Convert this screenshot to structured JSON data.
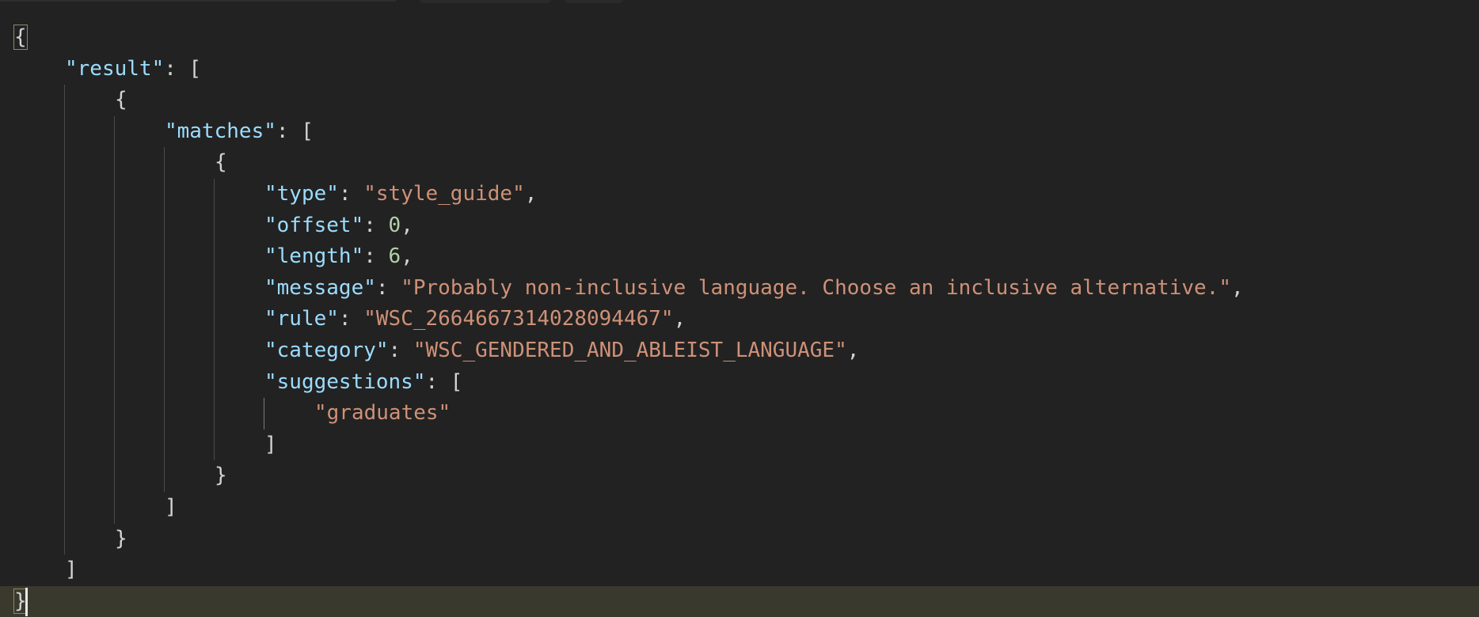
{
  "editor": {
    "lines": [
      {
        "tokens": [
          {
            "t": "{",
            "c": "pun"
          }
        ]
      },
      {
        "tokens": [
          {
            "t": "\"result\"",
            "c": "key"
          },
          {
            "t": ": [",
            "c": "pun"
          }
        ]
      },
      {
        "tokens": [
          {
            "t": "{",
            "c": "pun"
          }
        ]
      },
      {
        "tokens": [
          {
            "t": "\"matches\"",
            "c": "key"
          },
          {
            "t": ": [",
            "c": "pun"
          }
        ]
      },
      {
        "tokens": [
          {
            "t": "{",
            "c": "pun"
          }
        ]
      },
      {
        "tokens": [
          {
            "t": "\"type\"",
            "c": "key"
          },
          {
            "t": ": ",
            "c": "pun"
          },
          {
            "t": "\"style_guide\"",
            "c": "str"
          },
          {
            "t": ",",
            "c": "pun"
          }
        ]
      },
      {
        "tokens": [
          {
            "t": "\"offset\"",
            "c": "key"
          },
          {
            "t": ": ",
            "c": "pun"
          },
          {
            "t": "0",
            "c": "num"
          },
          {
            "t": ",",
            "c": "pun"
          }
        ]
      },
      {
        "tokens": [
          {
            "t": "\"length\"",
            "c": "key"
          },
          {
            "t": ": ",
            "c": "pun"
          },
          {
            "t": "6",
            "c": "num"
          },
          {
            "t": ",",
            "c": "pun"
          }
        ]
      },
      {
        "tokens": [
          {
            "t": "\"message\"",
            "c": "key"
          },
          {
            "t": ": ",
            "c": "pun"
          },
          {
            "t": "\"Probably non-inclusive language. Choose an inclusive alternative.\"",
            "c": "str"
          },
          {
            "t": ",",
            "c": "pun"
          }
        ]
      },
      {
        "tokens": [
          {
            "t": "\"rule\"",
            "c": "key"
          },
          {
            "t": ": ",
            "c": "pun"
          },
          {
            "t": "\"WSC_2664667314028094467\"",
            "c": "str"
          },
          {
            "t": ",",
            "c": "pun"
          }
        ]
      },
      {
        "tokens": [
          {
            "t": "\"category\"",
            "c": "key"
          },
          {
            "t": ": ",
            "c": "pun"
          },
          {
            "t": "\"WSC_GENDERED_AND_ABLEIST_LANGUAGE\"",
            "c": "str"
          },
          {
            "t": ",",
            "c": "pun"
          }
        ]
      },
      {
        "tokens": [
          {
            "t": "\"suggestions\"",
            "c": "key"
          },
          {
            "t": ": [",
            "c": "pun"
          }
        ]
      },
      {
        "tokens": [
          {
            "t": "\"graduates\"",
            "c": "str"
          }
        ]
      },
      {
        "tokens": [
          {
            "t": "]",
            "c": "pun"
          }
        ]
      },
      {
        "tokens": [
          {
            "t": "}",
            "c": "pun"
          }
        ]
      },
      {
        "tokens": [
          {
            "t": "]",
            "c": "pun"
          }
        ]
      },
      {
        "tokens": [
          {
            "t": "}",
            "c": "pun"
          }
        ]
      },
      {
        "tokens": [
          {
            "t": "]",
            "c": "pun"
          }
        ]
      },
      {
        "tokens": [
          {
            "t": "}",
            "c": "pun"
          }
        ]
      }
    ]
  },
  "colors": {
    "background": "#222222",
    "key": "#9cdcfe",
    "string": "#ce9178",
    "number": "#b5cea8",
    "punctuation": "#d4d4d4",
    "current_line": "#3a392d"
  }
}
